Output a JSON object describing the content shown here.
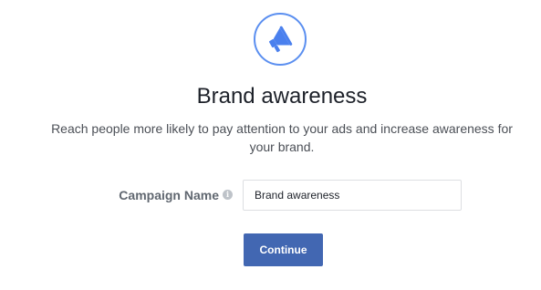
{
  "objective": {
    "icon": "megaphone-icon",
    "title": "Brand awareness",
    "description": "Reach people more likely to pay attention to your ads and increase awareness for your brand."
  },
  "form": {
    "campaign_name_label": "Campaign Name",
    "campaign_name_value": "Brand awareness",
    "info_icon": "info-icon"
  },
  "actions": {
    "continue_label": "Continue"
  },
  "colors": {
    "accent": "#5b8ff0",
    "button": "#4267b2"
  }
}
